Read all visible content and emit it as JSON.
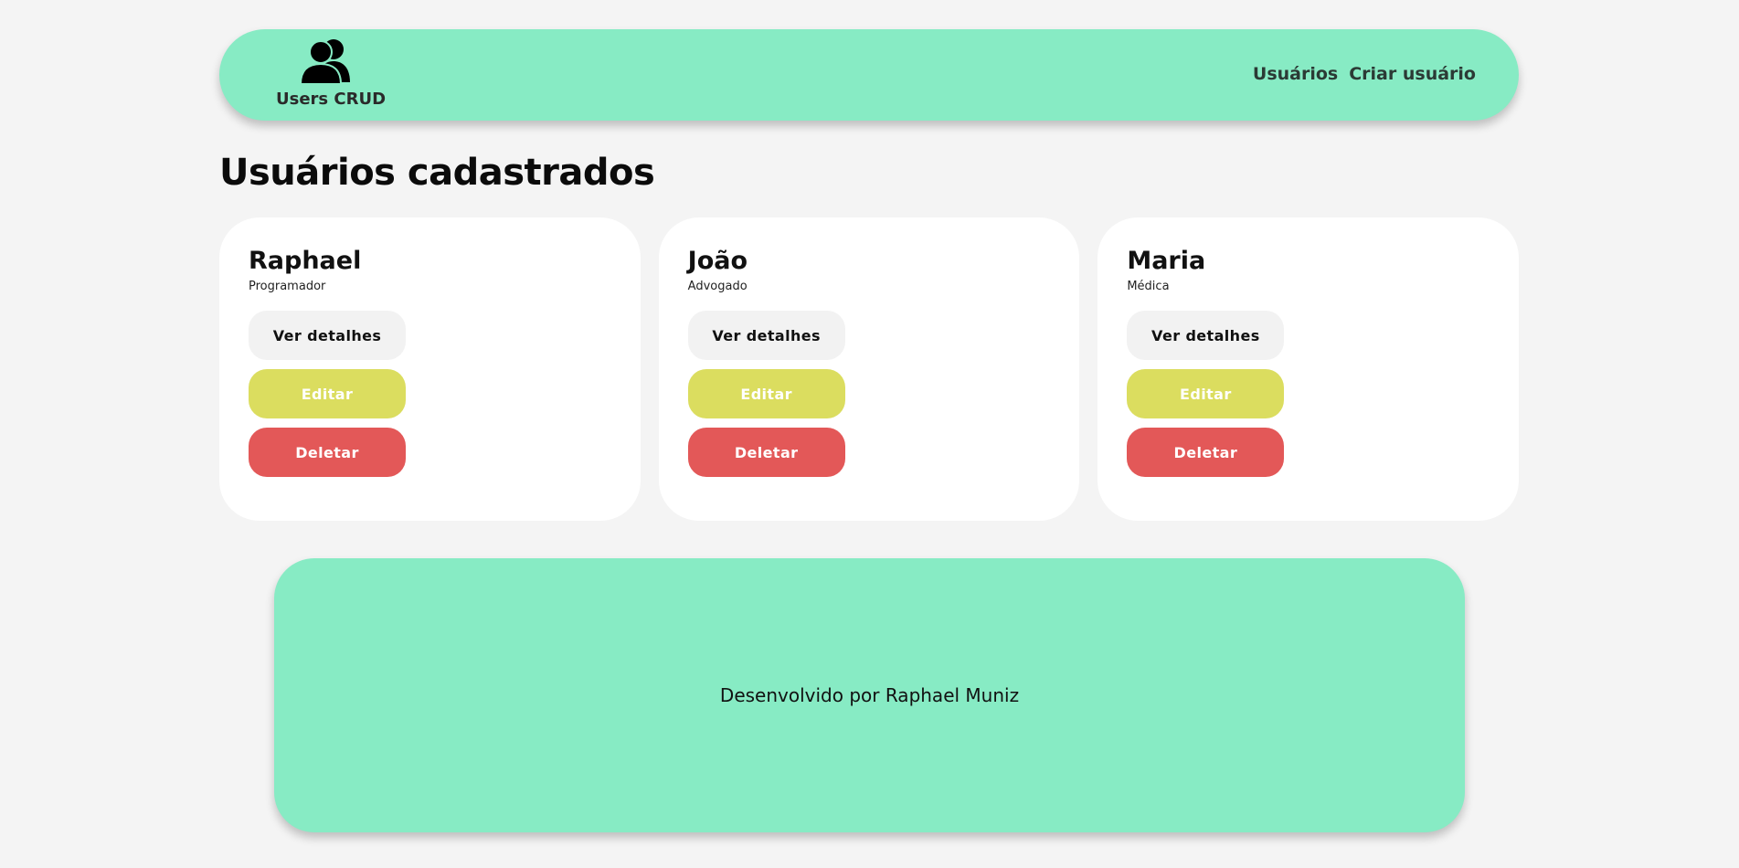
{
  "header": {
    "brand_title": "Users CRUD",
    "brand_icon": "users-icon",
    "nav": [
      {
        "label": "Usuários"
      },
      {
        "label": "Criar usuário"
      }
    ],
    "background_color": "#87ebc4"
  },
  "page_title": "Usuários cadastrados",
  "users": [
    {
      "name": "Raphael",
      "role": "Programador"
    },
    {
      "name": "João",
      "role": "Advogado"
    },
    {
      "name": "Maria",
      "role": "Médica"
    }
  ],
  "card_buttons": {
    "details_label": "Ver detalhes",
    "edit_label": "Editar",
    "delete_label": "Deletar",
    "edit_color": "#dbdd5f",
    "delete_color": "#e35858"
  },
  "footer": {
    "text": "Desenvolvido por Raphael Muniz"
  }
}
